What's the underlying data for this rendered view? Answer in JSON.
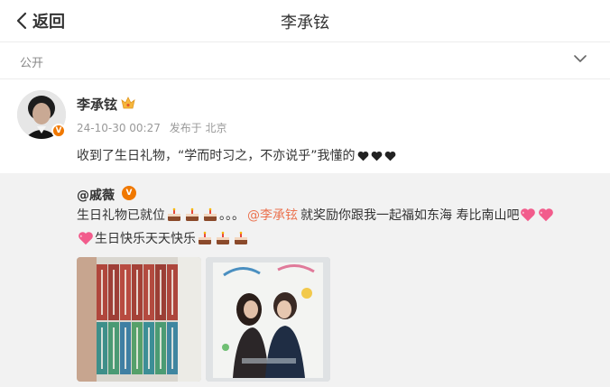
{
  "nav": {
    "back_label": "返回",
    "title": "李承铉"
  },
  "visibility": {
    "label": "公开"
  },
  "post": {
    "author": "李承铉",
    "timestamp": "24-10-30 00:27",
    "location": "发布于 北京",
    "text": "收到了生日礼物，“学而时习之，不亦说乎”我懂的"
  },
  "repost": {
    "author": "@戚薇",
    "line1_start": "生日礼物已就位",
    "line1_dots": "。。。",
    "mention": "@李承铉",
    "line1_end": "就奖励你跟我一起福如东海 寿比南山吧",
    "line2": "生日快乐天天快乐"
  },
  "colors": {
    "mention": "#eb7350",
    "badge": "#f07800",
    "repost_bg": "#f2f2f2"
  },
  "icons": [
    "back-arrow-icon",
    "chevron-down-icon",
    "verified-badge-icon",
    "crown-icon",
    "black-heart-icon",
    "cake-icon",
    "sparkling-heart-icon"
  ]
}
